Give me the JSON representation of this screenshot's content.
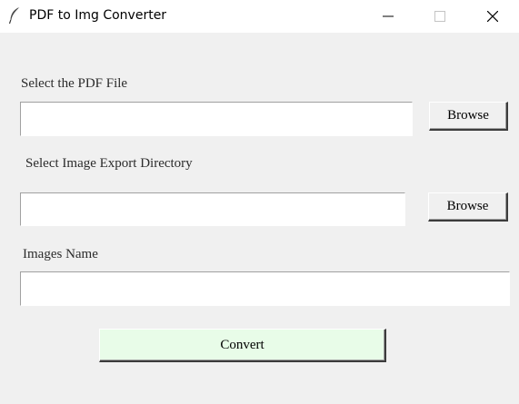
{
  "window": {
    "title": "PDF to Img Converter",
    "icon": "feather-icon"
  },
  "pdf_file": {
    "label": "Select the PDF File",
    "value": "",
    "browse_label": "Browse"
  },
  "export_dir": {
    "label": "Select Image Export Directory",
    "value": "",
    "browse_label": "Browse"
  },
  "images_name": {
    "label": "Images Name",
    "value": ""
  },
  "convert": {
    "label": "Convert",
    "color": "#e8fce8"
  }
}
